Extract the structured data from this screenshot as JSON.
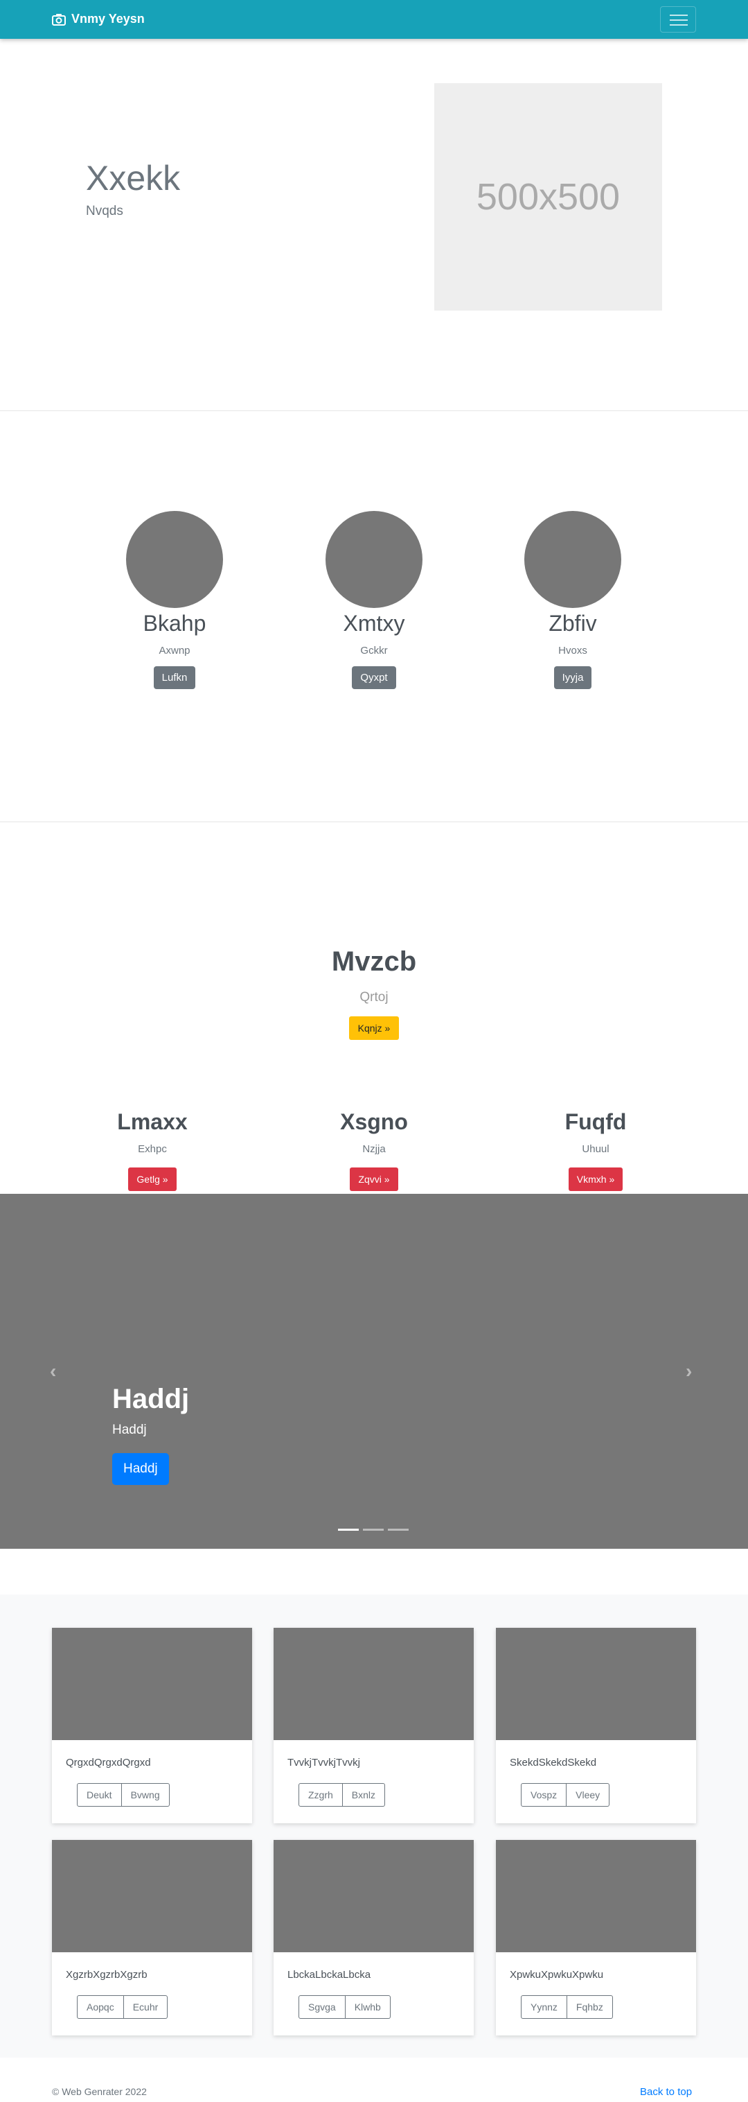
{
  "navbar": {
    "brand": "Vnmy Yeysn"
  },
  "hero": {
    "title": "Xxekk",
    "subtitle": "Nvqds",
    "placeholder": "500x500"
  },
  "people": [
    {
      "name": "Bkahp",
      "desc": "Axwnp",
      "button": "Lufkn"
    },
    {
      "name": "Xmtxy",
      "desc": "Gckkr",
      "button": "Qyxpt"
    },
    {
      "name": "Zbfiv",
      "desc": "Hvoxs",
      "button": "Iyyja"
    }
  ],
  "feature": {
    "title": "Mvzcb",
    "subtitle": "Qrtoj",
    "button": "Kqnjz »"
  },
  "columns": [
    {
      "title": "Lmaxx",
      "desc": "Exhpc",
      "button": "Getlg »"
    },
    {
      "title": "Xsgno",
      "desc": "Nzjja",
      "button": "Zqvvi »"
    },
    {
      "title": "Fuqfd",
      "desc": "Uhuul",
      "button": "Vkmxh »"
    }
  ],
  "carousel": {
    "title": "Haddj",
    "subtitle": "Haddj",
    "button": "Haddj"
  },
  "cards": [
    {
      "text": "QrgxdQrgxdQrgxd",
      "btn1": "Deukt",
      "btn2": "Bvwng"
    },
    {
      "text": "TvvkjTvvkjTvvkj",
      "btn1": "Zzgrh",
      "btn2": "Bxnlz"
    },
    {
      "text": "SkekdSkekdSkekd",
      "btn1": "Vospz",
      "btn2": "Vleey"
    },
    {
      "text": "XgzrbXgzrbXgzrb",
      "btn1": "Aopqc",
      "btn2": "Ecuhr"
    },
    {
      "text": "LbckaLbckaLbcka",
      "btn1": "Sgvga",
      "btn2": "Klwhb"
    },
    {
      "text": "XpwkuXpwkuXpwku",
      "btn1": "Yynnz",
      "btn2": "Fqhbz"
    }
  ],
  "footer": {
    "copyright": "© Web Genrater 2022",
    "back_to_top": "Back to top"
  }
}
